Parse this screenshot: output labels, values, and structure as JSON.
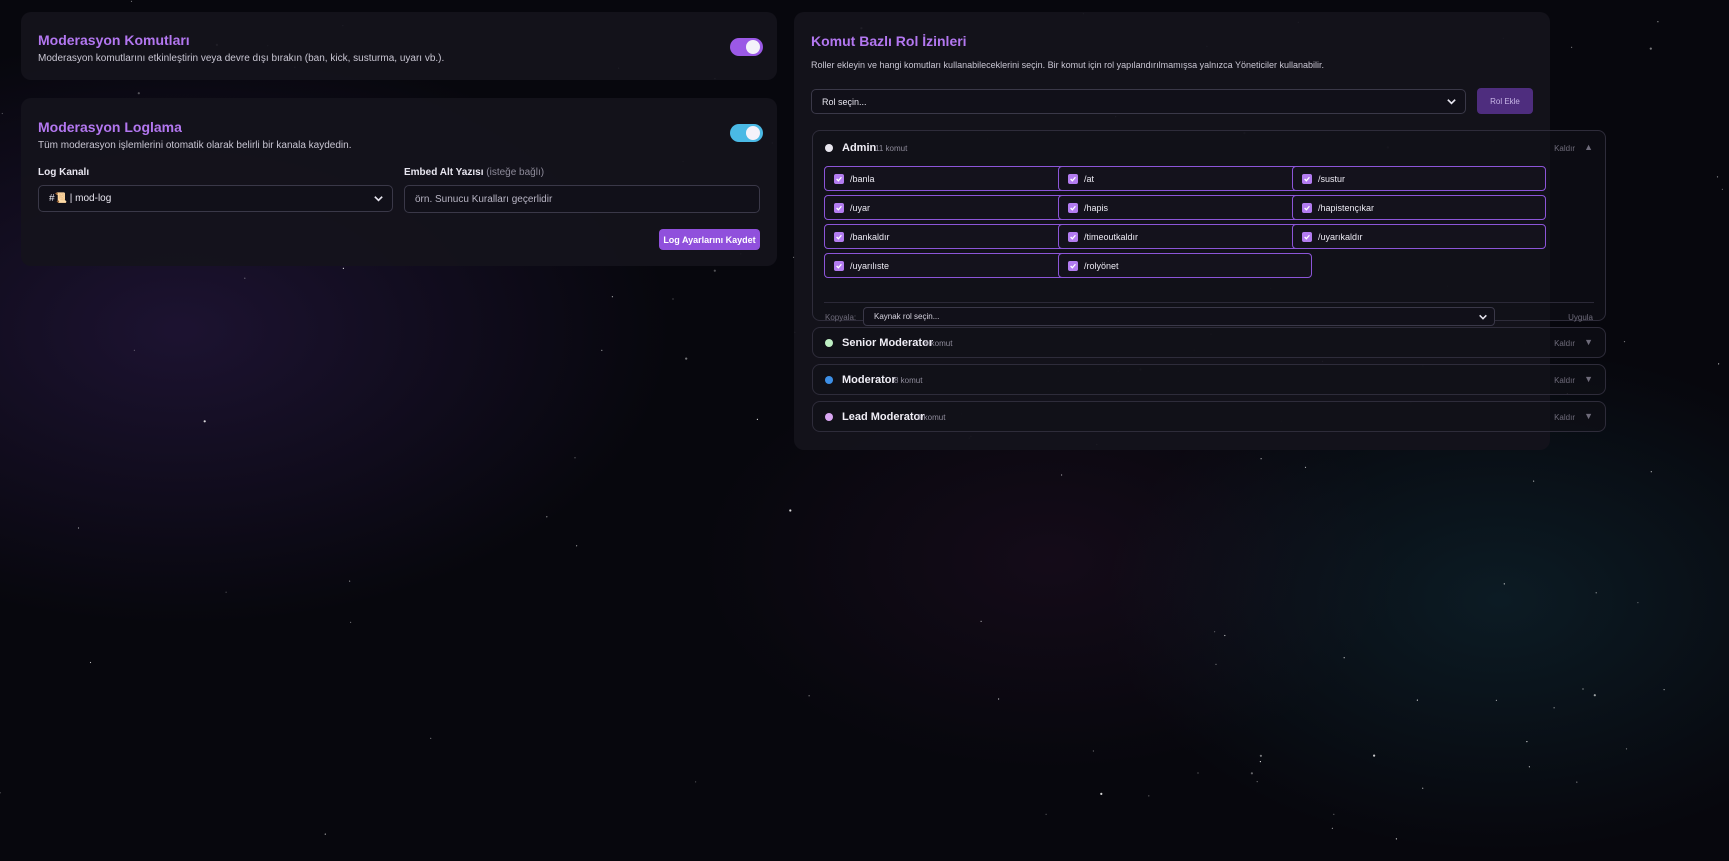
{
  "moderation": {
    "title": "Moderasyon Komutları",
    "description": "Moderasyon komutlarını etkinleştirin veya devre dışı bırakın (ban, kick, susturma, uyarı vb.).",
    "enabled": true,
    "toggle_color": "#9b59e6"
  },
  "logging": {
    "title": "Moderasyon Loglama",
    "description": "Tüm moderasyon işlemlerini otomatik olarak belirli bir kanala kaydedin.",
    "enabled": true,
    "toggle_color": "#4ab9e5",
    "channel_label": "Log Kanalı",
    "channel_value": "#📜 | mod-log",
    "footer_label": "Embed Alt Yazısı",
    "footer_optional": "(isteğe bağlı)",
    "footer_placeholder": "örn. Sunucu Kuralları geçerlidir",
    "save_label": "Log Ayarlarını Kaydet"
  },
  "permissions": {
    "title": "Komut Bazlı Rol İzinleri",
    "description": "Roller ekleyin ve hangi komutları kullanabileceklerini seçin. Bir komut için rol yapılandırılmamışsa yalnızca Yöneticiler kullanabilir.",
    "role_select_placeholder": "Rol seçin...",
    "add_role_label": "Rol Ekle",
    "remove_label": "Kaldır",
    "copy_label": "Kopyala:",
    "copy_placeholder": "Kaynak rol seçin...",
    "apply_label": "Uygula",
    "accent_color": "#b37cf0",
    "roles": [
      {
        "name": "Admin",
        "count": "11 komut",
        "color": "#e8e6ee",
        "expanded": true,
        "commands": [
          "/banla",
          "/at",
          "/sustur",
          "/uyar",
          "/hapis",
          "/hapistençıkar",
          "/bankaldır",
          "/timeoutkaldır",
          "/uyarıkaldır",
          "/uyarılıste",
          "/rolyönet"
        ]
      },
      {
        "name": "Senior Moderator",
        "count": "8 komut",
        "color": "#bff0c4",
        "expanded": false
      },
      {
        "name": "Moderator",
        "count": "8 komut",
        "color": "#3d8fe6",
        "expanded": false
      },
      {
        "name": "Lead Moderator",
        "count": "8 komut",
        "color": "#d9a6f2",
        "expanded": false
      }
    ]
  }
}
